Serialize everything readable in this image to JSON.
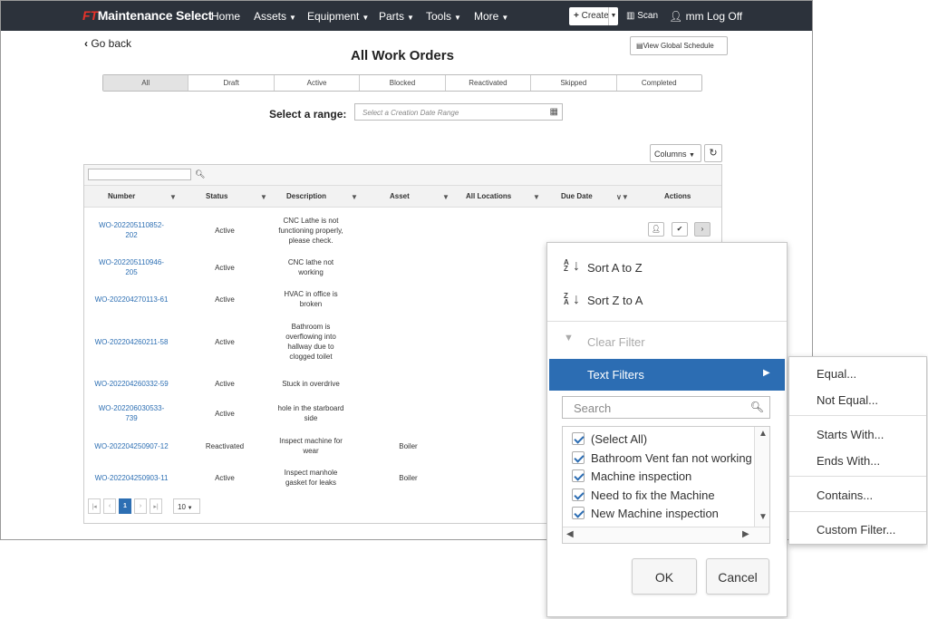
{
  "navbar": {
    "brand_prefix": "FT",
    "brand_name": "Maintenance Select",
    "items": [
      "Home",
      "Assets",
      "Equipment",
      "Parts",
      "Tools",
      "More"
    ],
    "create_label": "Create",
    "scan_label": "Scan",
    "user_label": "mm",
    "logoff_label": "Log Off"
  },
  "page": {
    "go_back": "Go back",
    "title": "All Work Orders",
    "global_schedule_label": "View Global Schedule",
    "status_tabs": [
      "All",
      "Draft",
      "Active",
      "Blocked",
      "Reactivated",
      "Skipped",
      "Completed"
    ],
    "active_tab": "All",
    "range_label": "Select a range:",
    "range_placeholder": "Select a Creation Date Range",
    "columns_label": "Columns"
  },
  "grid": {
    "headers": [
      "Number",
      "Status",
      "Description",
      "Asset",
      "All Locations",
      "Due Date",
      "Actions"
    ],
    "rows": [
      {
        "number": [
          "WO-202205110852-",
          "202"
        ],
        "status": "Active",
        "description": [
          "CNC Lathe is not",
          "functioning properly,",
          "please check."
        ],
        "asset": ""
      },
      {
        "number": [
          "WO-202205110946-",
          "205"
        ],
        "status": "Active",
        "description": [
          "CNC lathe not",
          "working"
        ],
        "asset": ""
      },
      {
        "number": [
          "WO-202204270113-61"
        ],
        "status": "Active",
        "description": [
          "HVAC in office is",
          "broken"
        ],
        "asset": ""
      },
      {
        "number": [
          "WO-202204260211-58"
        ],
        "status": "Active",
        "description": [
          "Bathroom is",
          "overflowing into",
          "hallway due to",
          "clogged toilet"
        ],
        "asset": ""
      },
      {
        "number": [
          "WO-202204260332-59"
        ],
        "status": "Active",
        "description": [
          "Stuck in overdrive"
        ],
        "asset": ""
      },
      {
        "number": [
          "WO-202206030533-",
          "739"
        ],
        "status": "Active",
        "description": [
          "hole in the starboard",
          "side"
        ],
        "asset": ""
      },
      {
        "number": [
          "WO-202204250907-12"
        ],
        "status": "Reactivated",
        "description": [
          "Inspect machine for",
          "wear"
        ],
        "asset": "Boiler"
      },
      {
        "number": [
          "WO-202204250903-11"
        ],
        "status": "Active",
        "description": [
          "Inspect manhole",
          "gasket for leaks"
        ],
        "asset": "Boiler"
      }
    ],
    "current_page": "1",
    "page_size": "10"
  },
  "filter_menu": {
    "sort_asc": "Sort A to Z",
    "sort_desc": "Sort Z to A",
    "clear_filter": "Clear Filter",
    "text_filters": "Text Filters",
    "search_placeholder": "Search",
    "items": [
      "(Select All)",
      "Bathroom Vent fan not working",
      "Machine inspection",
      "Need to fix the Machine",
      "New Machine inspection"
    ],
    "ok_label": "OK",
    "cancel_label": "Cancel"
  },
  "text_filter_submenu": {
    "items": [
      "Equal...",
      "Not Equal...",
      "Starts With...",
      "Ends With...",
      "Contains...",
      "Custom Filter..."
    ]
  },
  "colors": {
    "navbar_bg": "#2c323b",
    "brand_red": "#e8322a",
    "link_blue": "#2d6fb3",
    "menu_highlight": "#2c6db3"
  }
}
